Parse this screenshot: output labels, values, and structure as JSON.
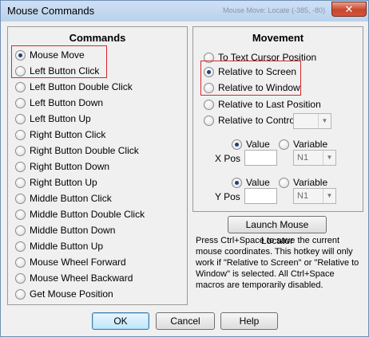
{
  "window": {
    "title": "Mouse Commands",
    "background_title": "Mouse Move: Locate (-385, -80)",
    "close_glyph": "✕"
  },
  "commands": {
    "title": "Commands",
    "items": [
      {
        "label": "Mouse Move",
        "checked": true
      },
      {
        "label": "Left Button Click",
        "checked": false
      },
      {
        "label": "Left Button Double Click",
        "checked": false
      },
      {
        "label": "Left Button Down",
        "checked": false
      },
      {
        "label": "Left Button Up",
        "checked": false
      },
      {
        "label": "Right Button Click",
        "checked": false
      },
      {
        "label": "Right Button Double Click",
        "checked": false
      },
      {
        "label": "Right Button Down",
        "checked": false
      },
      {
        "label": "Right Button Up",
        "checked": false
      },
      {
        "label": "Middle Button Click",
        "checked": false
      },
      {
        "label": "Middle Button Double Click",
        "checked": false
      },
      {
        "label": "Middle Button Down",
        "checked": false
      },
      {
        "label": "Middle Button Up",
        "checked": false
      },
      {
        "label": "Mouse Wheel Forward",
        "checked": false
      },
      {
        "label": "Mouse Wheel Backward",
        "checked": false
      },
      {
        "label": "Get Mouse Position",
        "checked": false
      }
    ]
  },
  "movement": {
    "title": "Movement",
    "options": [
      {
        "label": "To Text Cursor Position",
        "checked": false
      },
      {
        "label": "Relative to Screen",
        "checked": true
      },
      {
        "label": "Relative to Window",
        "checked": false
      },
      {
        "label": "Relative to Last Position",
        "checked": false
      },
      {
        "label": "Relative to Control:",
        "checked": false
      }
    ],
    "control_combo_value": "",
    "xpos": {
      "label": "X Pos",
      "value_label": "Value",
      "variable_label": "Variable",
      "value_checked": true,
      "input_value": "",
      "variable_value": "N1"
    },
    "ypos": {
      "label": "Y Pos",
      "value_label": "Value",
      "variable_label": "Variable",
      "value_checked": true,
      "input_value": "",
      "variable_value": "N1"
    },
    "launch_button": "Launch Mouse Locator",
    "info_text": "Press Ctrl+Space to save the current mouse coordinates.  This hotkey will only work if \"Relative to Screen\" or \"Relative to Window\" is selected.  All Ctrl+Space macros are temporarily disabled."
  },
  "footer": {
    "ok": "OK",
    "cancel": "Cancel",
    "help": "Help"
  },
  "colors": {
    "highlight_red": "#d9262c",
    "window_bg": "#f0f0f0",
    "titlebar": "#bcd3ed"
  }
}
